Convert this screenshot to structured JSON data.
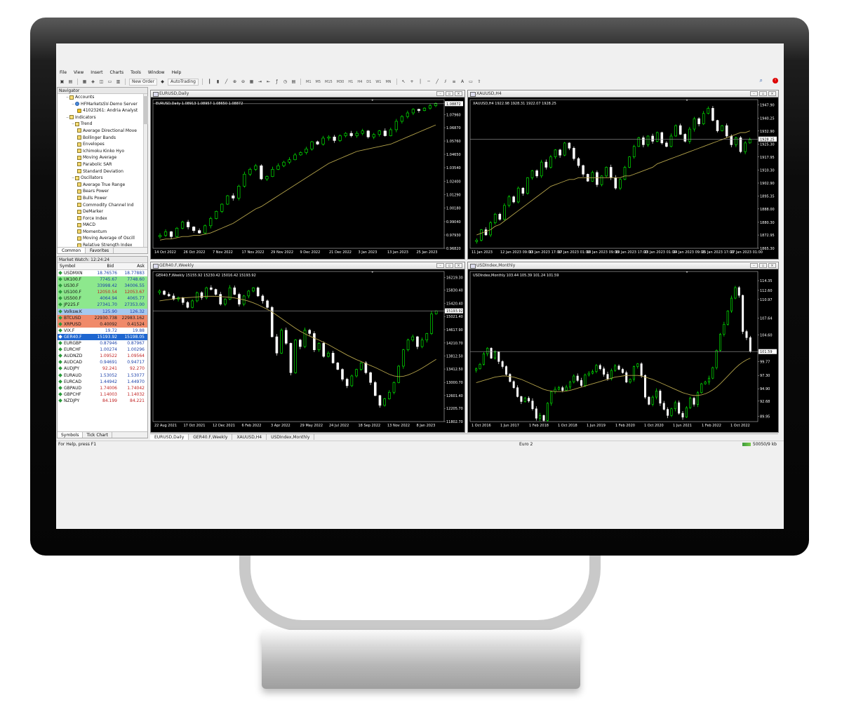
{
  "menu": [
    "File",
    "View",
    "Insert",
    "Charts",
    "Tools",
    "Window",
    "Help"
  ],
  "toolbar": {
    "new_order": "New Order",
    "autotrading": "AutoTrading",
    "timeframes": [
      "M1",
      "M5",
      "M15",
      "M30",
      "H1",
      "H4",
      "D1",
      "W1",
      "MN"
    ]
  },
  "navigator": {
    "title": "Navigator",
    "items": [
      {
        "label": "Accounts",
        "level": 1,
        "icon": "folder-icon"
      },
      {
        "label": "HFMarketsSV-Demo Server",
        "level": 2,
        "icon": "server-icon"
      },
      {
        "label": "41023261: Andria Analyst",
        "level": 3,
        "icon": "user-icon"
      },
      {
        "label": "Indicators",
        "level": 1,
        "icon": "folder-icon"
      },
      {
        "label": "Trend",
        "level": 2,
        "icon": "folder-icon"
      },
      {
        "label": "Average Directional Move",
        "level": 3,
        "icon": "indicator-icon"
      },
      {
        "label": "Bollinger Bands",
        "level": 3,
        "icon": "indicator-icon"
      },
      {
        "label": "Envelopes",
        "level": 3,
        "icon": "indicator-icon"
      },
      {
        "label": "Ichimoku Kinko Hyo",
        "level": 3,
        "icon": "indicator-icon"
      },
      {
        "label": "Moving Average",
        "level": 3,
        "icon": "indicator-icon"
      },
      {
        "label": "Parabolic SAR",
        "level": 3,
        "icon": "indicator-icon"
      },
      {
        "label": "Standard Deviation",
        "level": 3,
        "icon": "indicator-icon"
      },
      {
        "label": "Oscillators",
        "level": 2,
        "icon": "folder-icon"
      },
      {
        "label": "Average True Range",
        "level": 3,
        "icon": "indicator-icon"
      },
      {
        "label": "Bears Power",
        "level": 3,
        "icon": "indicator-icon"
      },
      {
        "label": "Bulls Power",
        "level": 3,
        "icon": "indicator-icon"
      },
      {
        "label": "Commodity Channel Ind",
        "level": 3,
        "icon": "indicator-icon"
      },
      {
        "label": "DeMarker",
        "level": 3,
        "icon": "indicator-icon"
      },
      {
        "label": "Force Index",
        "level": 3,
        "icon": "indicator-icon"
      },
      {
        "label": "MACD",
        "level": 3,
        "icon": "indicator-icon"
      },
      {
        "label": "Momentum",
        "level": 3,
        "icon": "indicator-icon"
      },
      {
        "label": "Moving Average of Oscill",
        "level": 3,
        "icon": "indicator-icon"
      },
      {
        "label": "Relative Strength Index",
        "level": 3,
        "icon": "indicator-icon"
      }
    ],
    "tabs": [
      "Common",
      "Favorites"
    ]
  },
  "market_watch": {
    "title": "Market Watch: 12:24:24",
    "headers": [
      "Symbol",
      "Bid",
      "Ask"
    ],
    "rows": [
      {
        "symbol": "USDMXN",
        "bid": "18.76576",
        "ask": "18.77883",
        "bg": "#ffffff",
        "color": "#1a3fa8"
      },
      {
        "symbol": "UK100.F",
        "bid": "7745.67",
        "ask": "7748.60",
        "bg": "#8de88d",
        "color": "#1a3fa8"
      },
      {
        "symbol": "US30.F",
        "bid": "33998.42",
        "ask": "34006.55",
        "bg": "#8de88d",
        "color": "#1a3fa8"
      },
      {
        "symbol": "US100.F",
        "bid": "12050.54",
        "ask": "12053.67",
        "bg": "#8de88d",
        "color": "#c02020"
      },
      {
        "symbol": "US500.F",
        "bid": "4064.94",
        "ask": "4065.77",
        "bg": "#8de88d",
        "color": "#1a3fa8"
      },
      {
        "symbol": "JP225.F",
        "bid": "27341.70",
        "ask": "27353.00",
        "bg": "#8de88d",
        "color": "#1a3fa8"
      },
      {
        "symbol": "Volksw.K",
        "bid": "125.90",
        "ask": "126.32",
        "bg": "#a6c8ee",
        "color": "#1a3fa8"
      },
      {
        "symbol": "BTCUSD",
        "bid": "22930.738",
        "ask": "22983.162",
        "bg": "#f08a6a",
        "color": "#1a1a1a"
      },
      {
        "symbol": "XRPUSD",
        "bid": "0.40092",
        "ask": "0.41524",
        "bg": "#f08a6a",
        "color": "#1a1a1a"
      },
      {
        "symbol": "VIX.F",
        "bid": "19.72",
        "ask": "19.88",
        "bg": "#ffffff",
        "color": "#1a3fa8"
      },
      {
        "symbol": "GER40.F",
        "bid": "15193.92",
        "ask": "15198.05",
        "bg": "#1e66d0",
        "color": "#ffffff"
      },
      {
        "symbol": "EURGBP",
        "bid": "0.87946",
        "ask": "0.87967",
        "bg": "#ffffff",
        "color": "#1a3fa8"
      },
      {
        "symbol": "EURCHF",
        "bid": "1.00274",
        "ask": "1.00296",
        "bg": "#ffffff",
        "color": "#1a3fa8"
      },
      {
        "symbol": "AUDNZD",
        "bid": "1.09522",
        "ask": "1.09564",
        "bg": "#ffffff",
        "color": "#c02020"
      },
      {
        "symbol": "AUDCAD",
        "bid": "0.94691",
        "ask": "0.94717",
        "bg": "#ffffff",
        "color": "#1a3fa8"
      },
      {
        "symbol": "AUDJPY",
        "bid": "92.241",
        "ask": "92.270",
        "bg": "#ffffff",
        "color": "#c02020"
      },
      {
        "symbol": "EURAUD",
        "bid": "1.53052",
        "ask": "1.53077",
        "bg": "#ffffff",
        "color": "#1a3fa8"
      },
      {
        "symbol": "EURCAD",
        "bid": "1.44942",
        "ask": "1.44970",
        "bg": "#ffffff",
        "color": "#1a3fa8"
      },
      {
        "symbol": "GBPAUD",
        "bid": "1.74006",
        "ask": "1.74042",
        "bg": "#ffffff",
        "color": "#c02020"
      },
      {
        "symbol": "GBPCHF",
        "bid": "1.14003",
        "ask": "1.14032",
        "bg": "#ffffff",
        "color": "#c02020"
      },
      {
        "symbol": "NZDJPY",
        "bid": "84.199",
        "ask": "84.221",
        "bg": "#ffffff",
        "color": "#c02020"
      }
    ],
    "tabs": [
      "Symbols",
      "Tick Chart"
    ]
  },
  "charts": [
    {
      "title": "EURUSD,Daily",
      "info": "EURUSD,Daily  1.08913 1.08957 1.08650 1.08872",
      "price_labels": [
        "1.08872",
        "1.07960",
        "1.06870",
        "1.05760",
        "1.04650",
        "1.03540",
        "1.02400",
        "1.01290",
        "1.00180",
        "0.99040",
        "0.97930",
        "0.96820"
      ],
      "date_labels": [
        "14 Oct 2022",
        "26 Oct 2022",
        "7 Nov 2022",
        "17 Nov 2022",
        "29 Nov 2022",
        "9 Dec 2022",
        "21 Dec 2022",
        "3 Jan 2023",
        "13 Jan 2023",
        "25 Jan 2023"
      ],
      "current_label": "1.08872",
      "closes": [
        0.979,
        0.982,
        0.978,
        0.985,
        0.99,
        0.986,
        0.983,
        0.981,
        0.987,
        0.993,
        0.999,
        1.005,
        1.012,
        1.01,
        1.02,
        1.03,
        1.034,
        1.037,
        1.026,
        1.028,
        1.034,
        1.037,
        1.04,
        1.042,
        1.046,
        1.048,
        1.051,
        1.057,
        1.055,
        1.06,
        1.061,
        1.058,
        1.062,
        1.064,
        1.062,
        1.064,
        1.066,
        1.061,
        1.063,
        1.066,
        1.062,
        1.067,
        1.074,
        1.078,
        1.081,
        1.084,
        1.083,
        1.085,
        1.087,
        1.089
      ],
      "ma": [
        0.975,
        0.976,
        0.976,
        0.977,
        0.978,
        0.978,
        0.979,
        0.979,
        0.98,
        0.981,
        0.983,
        0.985,
        0.987,
        0.989,
        0.992,
        0.995,
        0.998,
        1.001,
        1.003,
        1.006,
        1.009,
        1.012,
        1.015,
        1.018,
        1.021,
        1.024,
        1.027,
        1.03,
        1.033,
        1.036,
        1.039,
        1.041,
        1.043,
        1.045,
        1.047,
        1.049,
        1.05,
        1.051,
        1.052,
        1.053,
        1.054,
        1.055,
        1.057,
        1.059,
        1.061,
        1.063,
        1.065,
        1.067,
        1.069,
        1.071
      ],
      "ylim": [
        0.9682,
        1.0921
      ]
    },
    {
      "title": "XAUUSD,H4",
      "info": "XAUUSD,H4  1922.98 1928.31 1922.07 1928.25",
      "price_labels": [
        "1947.90",
        "1940.25",
        "1932.90",
        "1928.25",
        "1925.30",
        "1917.95",
        "1910.30",
        "1902.90",
        "1895.35",
        "1888.00",
        "1880.30",
        "1872.95",
        "1865.30"
      ],
      "date_labels": [
        "11 Jan 2023",
        "12 Jan 2023 09:00",
        "13 Jan 2023 17:00",
        "17 Jan 2023 01:00",
        "18 Jan 2023 09:00",
        "19 Jan 2023 17:00",
        "23 Jan 2023 01:00",
        "24 Jan 2023 09:00",
        "25 Jan 2023 17:00",
        "27 Jan 2023 01:00"
      ],
      "current_label": "1928.25",
      "closes": [
        1870,
        1876,
        1873,
        1880,
        1885,
        1882,
        1890,
        1895,
        1892,
        1900,
        1897,
        1906,
        1910,
        1907,
        1915,
        1912,
        1918,
        1922,
        1919,
        1926,
        1923,
        1917,
        1913,
        1908,
        1904,
        1909,
        1902,
        1907,
        1912,
        1906,
        1900,
        1905,
        1912,
        1918,
        1924,
        1929,
        1925,
        1930,
        1927,
        1932,
        1926,
        1924,
        1930,
        1936,
        1931,
        1927,
        1934,
        1940,
        1937,
        1943,
        1946,
        1939,
        1933,
        1936,
        1930,
        1925,
        1929,
        1921,
        1926,
        1928
      ],
      "ma": [
        1873,
        1874,
        1875,
        1876,
        1878,
        1879,
        1881,
        1883,
        1885,
        1887,
        1889,
        1891,
        1893,
        1895,
        1897,
        1899,
        1901,
        1902,
        1903,
        1904,
        1905,
        1905,
        1906,
        1906,
        1906,
        1906,
        1906,
        1906,
        1906,
        1906,
        1906,
        1906,
        1907,
        1907,
        1908,
        1909,
        1910,
        1911,
        1912,
        1914,
        1915,
        1916,
        1917,
        1918,
        1919,
        1920,
        1921,
        1922,
        1923,
        1924,
        1925,
        1926,
        1927,
        1928,
        1929,
        1930,
        1931,
        1932,
        1932,
        1933
      ],
      "ylim": [
        1865.3,
        1951.0
      ]
    },
    {
      "title": "GER40.F,Weekly",
      "info": "GER40.F,Weekly  15155.92 15230.42 15016.42 15193.92",
      "price_labels": [
        "16219.30",
        "15830.40",
        "15420.40",
        "15193.92",
        "15021.40",
        "14617.90",
        "14210.70",
        "13812.50",
        "13412.50",
        "13000.70",
        "12601.40",
        "12205.70",
        "11802.70"
      ],
      "date_labels": [
        "22 Aug 2021",
        "17 Oct 2021",
        "12 Dec 2021",
        "6 Feb 2022",
        "3 Apr 2022",
        "29 May 2022",
        "24 Jul 2022",
        "18 Sep 2022",
        "13 Nov 2022",
        "8 Jan 2023"
      ],
      "current_label": "15193.92",
      "closes": [
        15800,
        15700,
        15650,
        15550,
        15600,
        15450,
        15300,
        15500,
        15750,
        15600,
        15900,
        15850,
        15700,
        15400,
        15550,
        15900,
        15700,
        15400,
        15650,
        15800,
        15900,
        15650,
        15500,
        15300,
        14400,
        13900,
        14600,
        14200,
        13300,
        14300,
        14100,
        14600,
        14500,
        14000,
        14200,
        13800,
        13900,
        13600,
        13400,
        13100,
        12900,
        13200,
        13400,
        13600,
        13300,
        13000,
        12600,
        12300,
        12500,
        12700,
        13000,
        13500,
        14000,
        14300,
        14400,
        14100,
        14300,
        14500,
        15100,
        15193
      ],
      "ma": [
        15500,
        15520,
        15540,
        15560,
        15580,
        15590,
        15600,
        15610,
        15620,
        15630,
        15640,
        15640,
        15640,
        15630,
        15620,
        15610,
        15590,
        15560,
        15530,
        15490,
        15440,
        15380,
        15310,
        15240,
        15160,
        15060,
        14960,
        14860,
        14760,
        14660,
        14570,
        14490,
        14420,
        14360,
        14300,
        14230,
        14160,
        14080,
        14000,
        13920,
        13840,
        13770,
        13700,
        13640,
        13580,
        13520,
        13460,
        13390,
        13320,
        13250,
        13200,
        13180,
        13190,
        13230,
        13290,
        13360,
        13440,
        13530,
        13620,
        13710
      ],
      "ylim": [
        11802.7,
        16400
      ]
    },
    {
      "title": "USDIndex,Monthly",
      "info": "USDIndex,Monthly  103.44 105.39 101.24 101.59",
      "price_labels": [
        "114.35",
        "112.60",
        "110.97",
        "107.64",
        "104.60",
        "101.59",
        "99.77",
        "97.30",
        "94.90",
        "92.68",
        "89.95"
      ],
      "date_labels": [
        "1 Oct 2016",
        "1 Jun 2017",
        "1 Feb 2018",
        "1 Oct 2018",
        "1 Jun 2019",
        "1 Feb 2020",
        "1 Oct 2020",
        "1 Jun 2021",
        "1 Feb 2022",
        "1 Oct 2022"
      ],
      "current_label": "101.59",
      "closes": [
        98.5,
        99.3,
        101.2,
        102.2,
        100.4,
        101.5,
        99.8,
        98.9,
        97.5,
        96.2,
        95.1,
        93.5,
        92.6,
        93.2,
        92.7,
        91.3,
        89.6,
        90.1,
        89.2,
        92.3,
        94.4,
        94.8,
        95.1,
        94.6,
        95.2,
        96.1,
        97.2,
        96.4,
        95.5,
        97.4,
        97.7,
        98.0,
        99.1,
        98.5,
        97.5,
        96.7,
        98.2,
        99.0,
        98.4,
        97.8,
        96.1,
        96.6,
        98.9,
        99.4,
        97.3,
        93.4,
        92.1,
        93.4,
        94.5,
        92.3,
        91.2,
        90.1,
        91.3,
        92.4,
        90.5,
        89.8,
        91.5,
        93.2,
        92.1,
        94.2,
        95.8,
        96.1,
        96.8,
        98.7,
        101.8,
        104.7,
        106.5,
        108.9,
        111.2,
        113.1,
        111.7,
        105.2,
        104.1,
        101.6
      ],
      "ma": [
        96.0,
        96.2,
        96.4,
        96.6,
        96.8,
        97.0,
        97.1,
        97.2,
        97.2,
        97.1,
        97.0,
        96.8,
        96.6,
        96.3,
        96.0,
        95.7,
        95.4,
        95.1,
        94.8,
        94.6,
        94.5,
        94.4,
        94.4,
        94.4,
        94.5,
        94.6,
        94.8,
        95.0,
        95.2,
        95.4,
        95.6,
        95.8,
        96.0,
        96.2,
        96.4,
        96.6,
        96.8,
        97.0,
        97.1,
        97.2,
        97.3,
        97.3,
        97.3,
        97.3,
        97.2,
        97.0,
        96.8,
        96.6,
        96.3,
        96.0,
        95.7,
        95.4,
        95.1,
        94.8,
        94.5,
        94.2,
        94.0,
        93.8,
        93.7,
        93.7,
        93.8,
        94.0,
        94.3,
        94.7,
        95.2,
        95.8,
        96.5,
        97.2,
        97.9,
        98.6,
        99.2,
        99.7,
        100.1,
        100.4
      ],
      "ylim": [
        89.0,
        116.0
      ]
    }
  ],
  "chart_tabs": [
    "EURUSD,Daily",
    "GER40.F,Weekly",
    "XAUUSD,H4",
    "USDIndex,Monthly"
  ],
  "status": {
    "help": "For Help, press F1",
    "profile": "Euro 2",
    "traffic": "50050/9 kb"
  },
  "colors": {
    "bull": "#00ff00",
    "bear": "#ffffff",
    "ma": "#b3a24a",
    "grid": "#ffffff",
    "chart_bg": "#000000"
  }
}
